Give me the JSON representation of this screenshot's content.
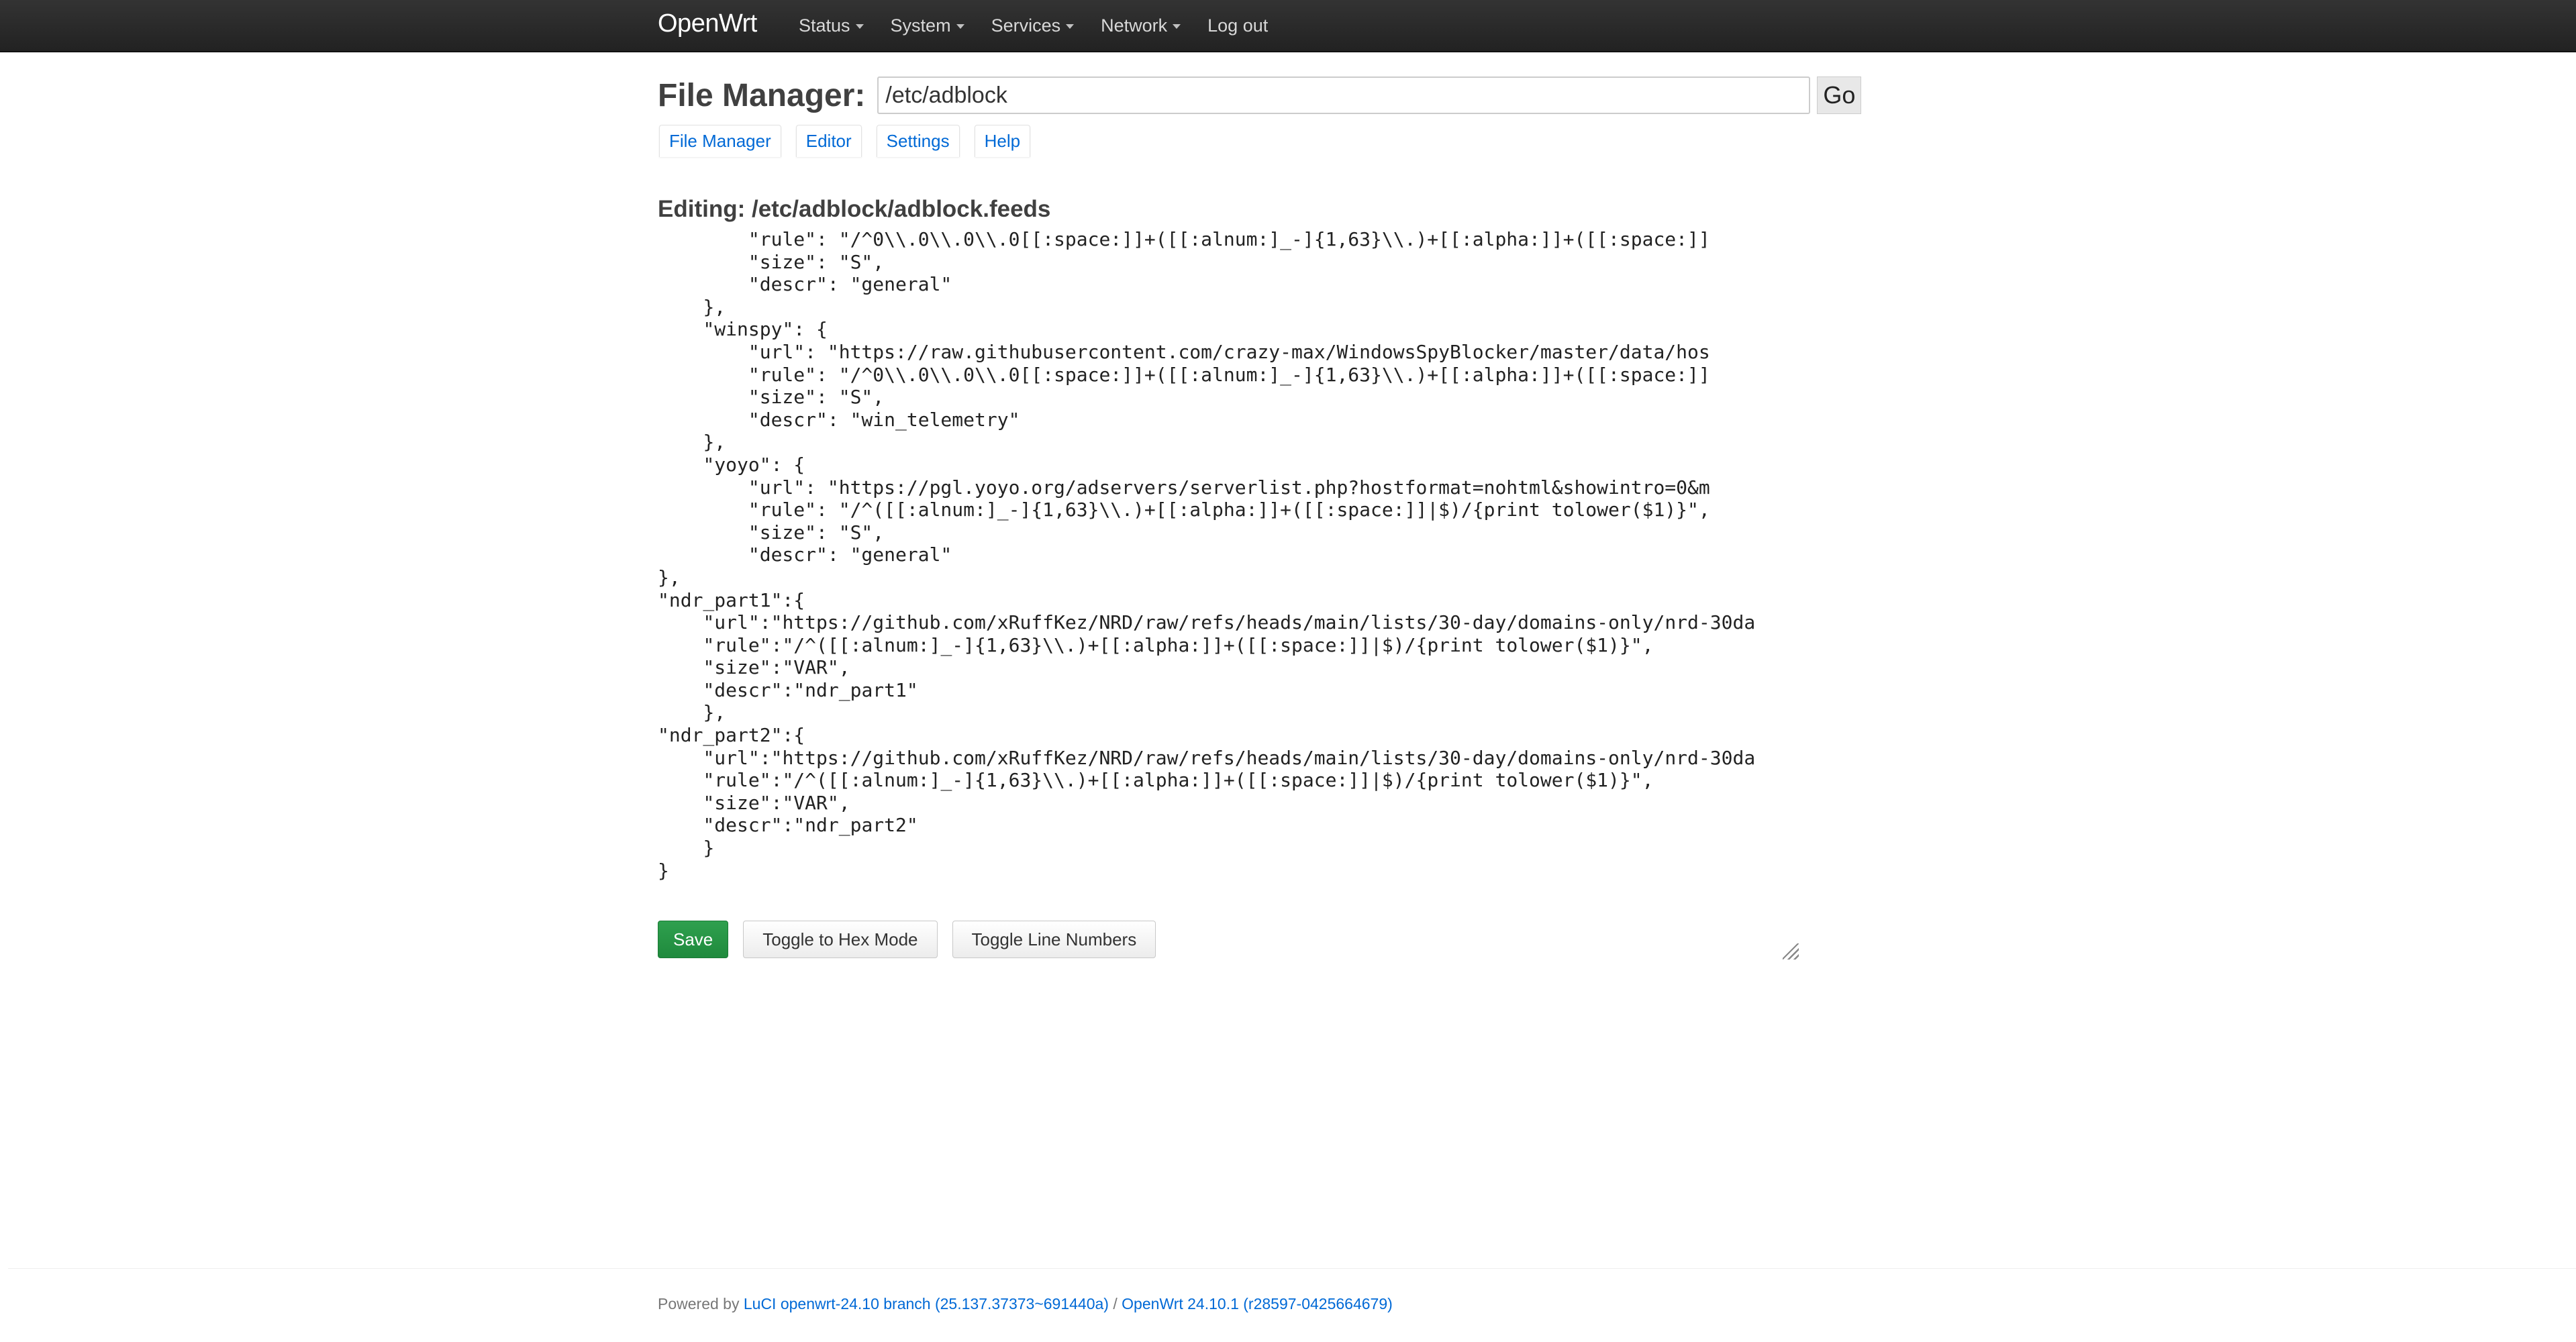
{
  "navbar": {
    "brand": "OpenWrt",
    "items": [
      {
        "label": "Status",
        "dropdown": true
      },
      {
        "label": "System",
        "dropdown": true
      },
      {
        "label": "Services",
        "dropdown": true
      },
      {
        "label": "Network",
        "dropdown": true
      },
      {
        "label": "Log out",
        "dropdown": false
      }
    ]
  },
  "file_manager": {
    "title": "File Manager:",
    "path_value": "/etc/adblock",
    "go_label": "Go",
    "tabs": [
      "File Manager",
      "Editor",
      "Settings",
      "Help"
    ]
  },
  "editor": {
    "title": "Editing: /etc/adblock/adblock.feeds",
    "content": "\t\t\"rule\": \"/^0\\\\.0\\\\.0\\\\.0[[:space:]]+([[:alnum:]_-]{1,63}\\\\.)+[[:alpha:]]+([[:space:]]\n\t\t\"size\": \"S\",\n\t\t\"descr\": \"general\"\n\t},\n\t\"winspy\": {\n\t\t\"url\": \"https://raw.githubusercontent.com/crazy-max/WindowsSpyBlocker/master/data/hos\n\t\t\"rule\": \"/^0\\\\.0\\\\.0\\\\.0[[:space:]]+([[:alnum:]_-]{1,63}\\\\.)+[[:alpha:]]+([[:space:]]\n\t\t\"size\": \"S\",\n\t\t\"descr\": \"win_telemetry\"\n\t},\n\t\"yoyo\": {\n\t\t\"url\": \"https://pgl.yoyo.org/adservers/serverlist.php?hostformat=nohtml&showintro=0&m\n\t\t\"rule\": \"/^([[:alnum:]_-]{1,63}\\\\.)+[[:alpha:]]+([[:space:]]|$)/{print tolower($1)}\",\n\t\t\"size\": \"S\",\n\t\t\"descr\": \"general\"\n},\n\"ndr_part1\":{\n\t\"url\":\"https://github.com/xRuffKez/NRD/raw/refs/heads/main/lists/30-day/domains-only/nrd-30da\n\t\"rule\":\"/^([[:alnum:]_-]{1,63}\\\\.)+[[:alpha:]]+([[:space:]]|$)/{print tolower($1)}\",\n\t\"size\":\"VAR\",\n\t\"descr\":\"ndr_part1\"\n\t},\n\"ndr_part2\":{\n\t\"url\":\"https://github.com/xRuffKez/NRD/raw/refs/heads/main/lists/30-day/domains-only/nrd-30da\n\t\"rule\":\"/^([[:alnum:]_-]{1,63}\\\\.)+[[:alpha:]]+([[:space:]]|$)/{print tolower($1)}\",\n\t\"size\":\"VAR\",\n\t\"descr\":\"ndr_part2\"\n\t}\n}"
  },
  "actions": {
    "save": "Save",
    "hex": "Toggle to Hex Mode",
    "line_numbers": "Toggle Line Numbers"
  },
  "footer": {
    "prefix": "Powered by ",
    "luci_link": "LuCI openwrt-24.10 branch (25.137.37373~691440a)",
    "separator": " / ",
    "openwrt_link": "OpenWrt 24.10.1 (r28597-0425664679)"
  },
  "colors": {
    "navbar_bg": "#282828",
    "link": "#0069d6",
    "save_button": "#23904a"
  }
}
